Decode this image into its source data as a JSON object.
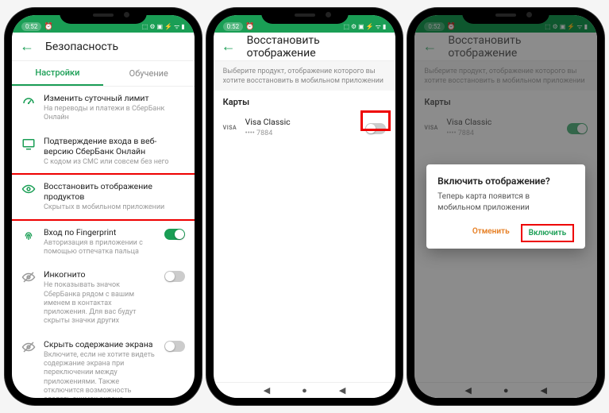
{
  "status": {
    "time": "0:52",
    "icons": "⬚ ⚙ ▣ ⚡ ᯤ ▮"
  },
  "screen1": {
    "title": "Безопасность",
    "tabs": {
      "settings": "Настройки",
      "learning": "Обучение"
    },
    "items": [
      {
        "label": "Изменить суточный лимит",
        "sub": "На переводы и платежи в СберБанк Онлайн"
      },
      {
        "label": "Подтверждение входа в веб-версию СберБанк Онлайн",
        "sub": "С кодом из СМС или совсем без него"
      },
      {
        "label": "Восстановить отображение продуктов",
        "sub": "Скрытых в мобильном приложении"
      },
      {
        "label": "Вход по Fingerprint",
        "sub": "Авторизация в приложении с помощью отпечатка пальца"
      },
      {
        "label": "Инкогнито",
        "sub": "Не показывать значок СберБанка рядом с вашим именем в контактах приложения. Для вас будут скрыты значки других"
      },
      {
        "label": "Скрыть содержание экрана",
        "sub": "Включите, если не хотите видеть содержание экрана при переключении между приложениями. Также отключится возможность сделать снимок экрана"
      }
    ]
  },
  "screen2": {
    "title": "Восстановить отображение",
    "hint": "Выберите продукт, отображение которого вы хотите восстановить в мобильном приложении",
    "section": "Карты",
    "card": {
      "brand": "VISA",
      "name": "Visa Classic",
      "mask": "•••• 7884"
    }
  },
  "screen3": {
    "dialog": {
      "title": "Включить отображение?",
      "body": "Теперь карта появится в мобильном приложении",
      "cancel": "Отменить",
      "ok": "Включить"
    }
  }
}
